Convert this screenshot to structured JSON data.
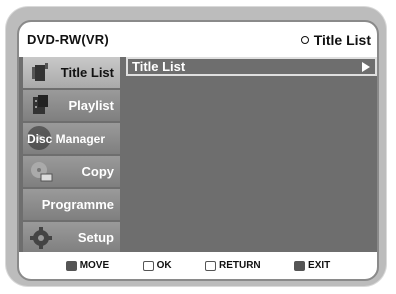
{
  "header": {
    "left_title": "DVD-RW(VR)",
    "right_title": "Title List",
    "right_icon": "circle-icon"
  },
  "sidebar": {
    "items": [
      {
        "label": "Title List",
        "icon": "film-icon"
      },
      {
        "label": "Playlist",
        "icon": "film-strip-icon"
      },
      {
        "label": "Disc Manager",
        "icon": "disc-icon"
      },
      {
        "label": "Copy",
        "icon": "copy-icon"
      },
      {
        "label": "Programme",
        "icon": ""
      },
      {
        "label": "Setup",
        "icon": "gear-icon"
      }
    ],
    "active_index": 0
  },
  "content": {
    "rows": [
      {
        "label": "Title List"
      }
    ]
  },
  "footer": {
    "move_label": "MOVE",
    "ok_label": "OK",
    "return_label": "RETURN",
    "exit_label": "EXIT"
  },
  "colors": {
    "panel": "#6e6e6e",
    "sidebar": "#8a8a8a",
    "active": "#bdbdbd",
    "frame": "#bcbcbc"
  }
}
